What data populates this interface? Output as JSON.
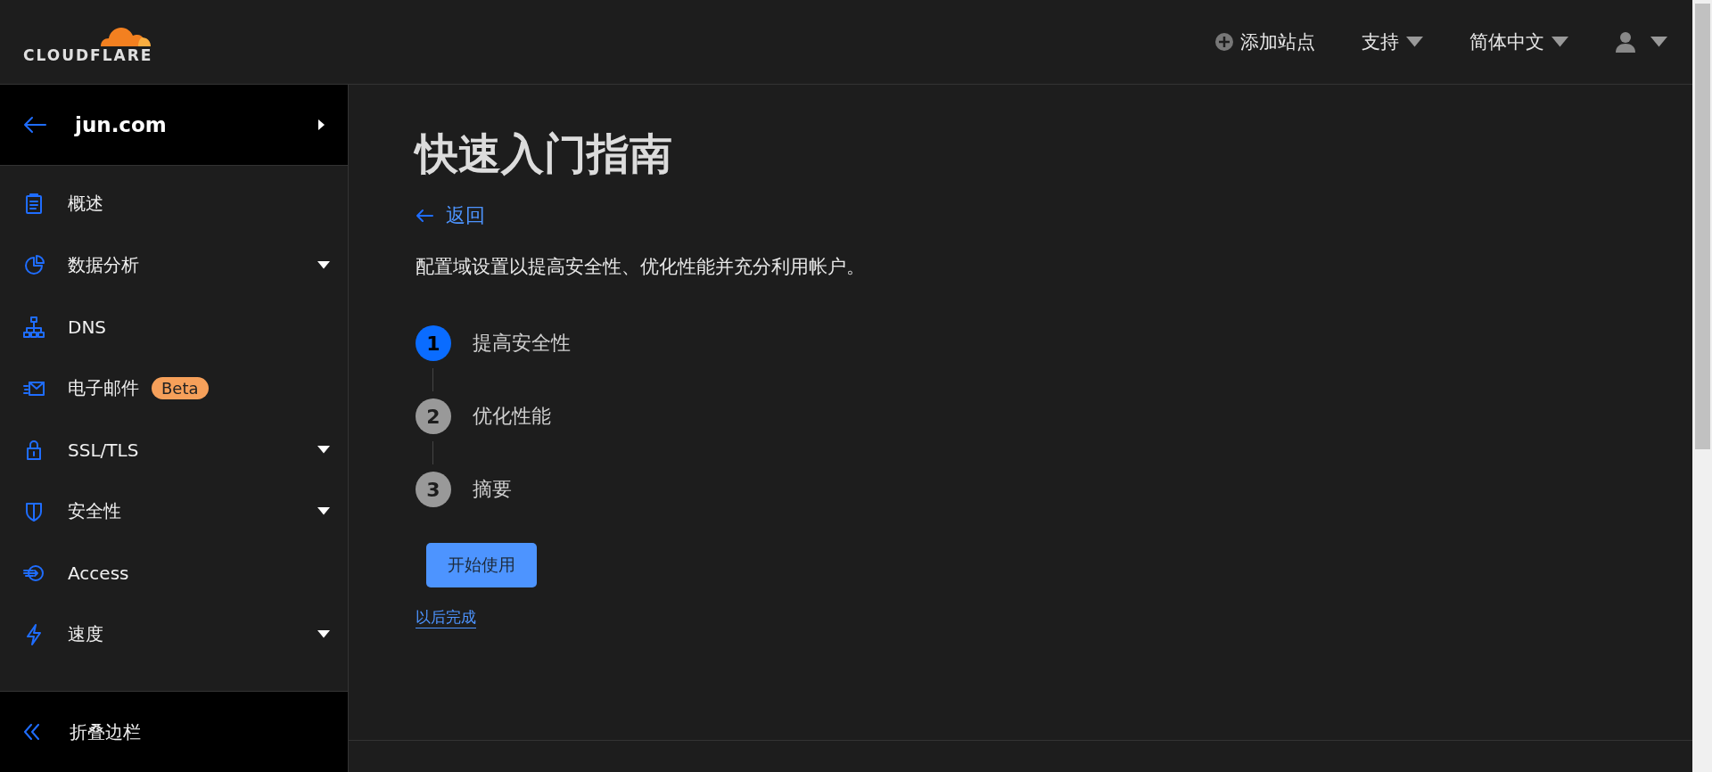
{
  "header": {
    "logo": "CLOUDFLARE",
    "actions": [
      {
        "kind": "add",
        "label": "添加站点"
      },
      {
        "kind": "menu",
        "label": "支持"
      },
      {
        "kind": "menu",
        "label": "简体中文"
      },
      {
        "kind": "user"
      }
    ]
  },
  "sidebar": {
    "domain": "jun.com",
    "items": [
      {
        "label": "概述",
        "expandable": false
      },
      {
        "label": "数据分析",
        "expandable": true
      },
      {
        "label": "DNS",
        "expandable": false
      },
      {
        "label": "电子邮件",
        "expandable": false,
        "badge": "Beta"
      },
      {
        "label": "SSL/TLS",
        "expandable": true
      },
      {
        "label": "安全性",
        "expandable": true
      },
      {
        "label": "Access",
        "expandable": false
      },
      {
        "label": "速度",
        "expandable": true
      }
    ],
    "collapse": "折叠边栏"
  },
  "main": {
    "title": "快速入门指南",
    "back": "返回",
    "description": "配置域设置以提高安全性、优化性能并充分利用帐户。",
    "steps": [
      {
        "number": "1",
        "label": "提高安全性",
        "selected": true
      },
      {
        "number": "2",
        "label": "优化性能",
        "selected": false
      },
      {
        "number": "3",
        "label": "摘要",
        "selected": false
      }
    ],
    "start_button": "开始使用",
    "later_link": "以后完成"
  }
}
